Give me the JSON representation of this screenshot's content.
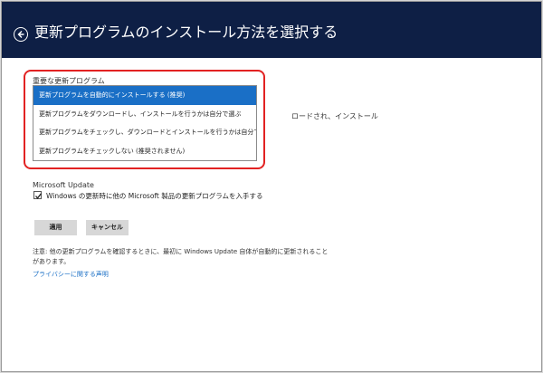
{
  "header": {
    "title": "更新プログラムのインストール方法を選択する"
  },
  "important_updates": {
    "label": "重要な更新プログラム",
    "options": [
      "更新プログラムを自動的にインストールする (推奨)",
      "更新プログラムをダウンロードし、インストールを行うかは自分で選ぶ",
      "更新プログラムをチェックし、ダウンロードとインストールを行うかは自分で選ぶ",
      "更新プログラムをチェックしない (推奨されません)"
    ],
    "selected_index": 0,
    "partially_hidden_text": "ロードされ、インストール"
  },
  "microsoft_update": {
    "title": "Microsoft Update",
    "checkbox_label": "Windows の更新時に他の Microsoft 製品の更新プログラムを入手する",
    "checked": true
  },
  "buttons": {
    "apply": "適用",
    "cancel": "キャンセル"
  },
  "note": {
    "line1": "注意: 他の更新プログラムを確認するときに、最初に Windows Update 自体が自動的に更新されること",
    "line2": "があります。"
  },
  "privacy_link": "プライバシーに関する声明",
  "colors": {
    "header_bg": "#0e1f45",
    "selection": "#1a6fc6",
    "highlight_border": "#e22222",
    "link": "#1a6fc6"
  }
}
